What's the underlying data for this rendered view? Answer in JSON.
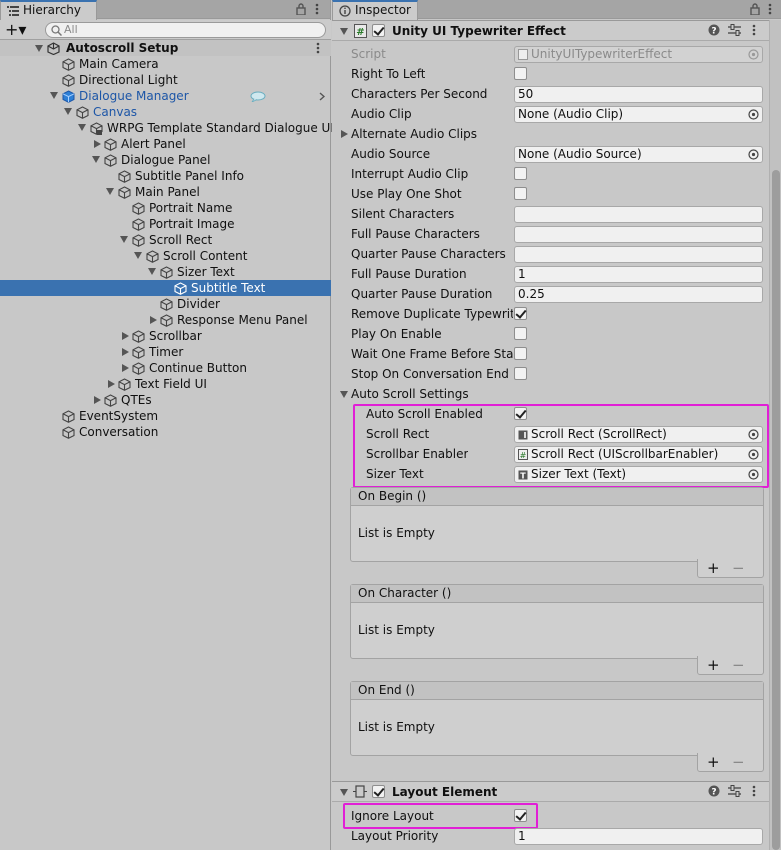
{
  "hierarchy": {
    "tab_label": "Hierarchy",
    "search_placeholder": "All",
    "add_label": "+▾",
    "scene": "Autoscroll Setup",
    "items": [
      {
        "label": "Main Camera"
      },
      {
        "label": "Directional Light"
      },
      {
        "label": "Dialogue Manager"
      },
      {
        "label": "Canvas"
      },
      {
        "label": "WRPG Template Standard Dialogue UI"
      },
      {
        "label": "Alert Panel"
      },
      {
        "label": "Dialogue Panel"
      },
      {
        "label": "Subtitle Panel Info"
      },
      {
        "label": "Main Panel"
      },
      {
        "label": "Portrait Name"
      },
      {
        "label": "Portrait Image"
      },
      {
        "label": "Scroll Rect"
      },
      {
        "label": "Scroll Content"
      },
      {
        "label": "Sizer Text"
      },
      {
        "label": "Subtitle Text"
      },
      {
        "label": "Divider"
      },
      {
        "label": "Response Menu Panel"
      },
      {
        "label": "Scrollbar"
      },
      {
        "label": "Timer"
      },
      {
        "label": "Continue Button"
      },
      {
        "label": "Text Field UI"
      },
      {
        "label": "QTEs"
      },
      {
        "label": "EventSystem"
      },
      {
        "label": "Conversation"
      }
    ]
  },
  "inspector": {
    "tab_label": "Inspector",
    "component1": {
      "title": "Unity UI Typewriter Effect",
      "props": [
        {
          "label": "Script",
          "value": "UnityUITypewriterEffect"
        },
        {
          "label": "Right To Left"
        },
        {
          "label": "Characters Per Second",
          "value": "50"
        },
        {
          "label": "Audio Clip",
          "value": "None (Audio Clip)"
        },
        {
          "label": "Alternate Audio Clips"
        },
        {
          "label": "Audio Source",
          "value": "None (Audio Source)"
        },
        {
          "label": "Interrupt Audio Clip"
        },
        {
          "label": "Use Play One Shot"
        },
        {
          "label": "Silent Characters",
          "value": ""
        },
        {
          "label": "Full Pause Characters",
          "value": ""
        },
        {
          "label": "Quarter Pause Characters",
          "value": ""
        },
        {
          "label": "Full Pause Duration",
          "value": "1"
        },
        {
          "label": "Quarter Pause Duration",
          "value": "0.25"
        },
        {
          "label": "Remove Duplicate Typewriter Effects"
        },
        {
          "label": "Play On Enable"
        },
        {
          "label": "Wait One Frame Before Starting"
        },
        {
          "label": "Stop On Conversation End"
        },
        {
          "label": "Auto Scroll Settings"
        },
        {
          "label": "Auto Scroll Enabled"
        },
        {
          "label": "Scroll Rect",
          "value": "Scroll Rect (ScrollRect)"
        },
        {
          "label": "Scrollbar Enabler",
          "value": "Scroll Rect (UIScrollbarEnabler)"
        },
        {
          "label": "Sizer Text",
          "value": "Sizer Text (Text)"
        }
      ],
      "events": [
        {
          "title": "On Begin ()",
          "body": "List is Empty"
        },
        {
          "title": "On Character ()",
          "body": "List is Empty"
        },
        {
          "title": "On End ()",
          "body": "List is Empty"
        }
      ],
      "plus": "+",
      "minus": "−"
    },
    "component2": {
      "title": "Layout Element",
      "props": [
        {
          "label": "Ignore Layout"
        },
        {
          "label": "Layout Priority",
          "value": "1"
        }
      ]
    },
    "colors": {
      "highlight": "#e11fd6",
      "selection": "#3a72b0",
      "link_blue": "#1d56a7"
    }
  }
}
